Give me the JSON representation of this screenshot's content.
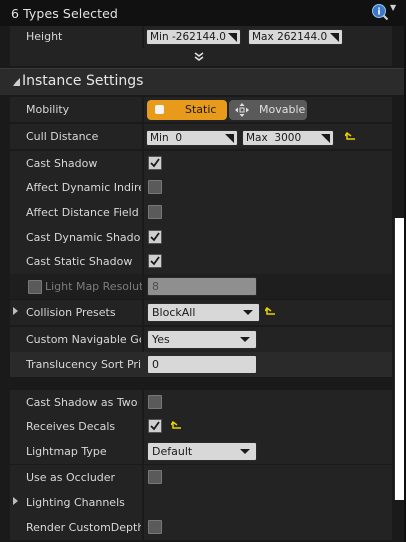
{
  "header": {
    "title": "6 Types Selected"
  },
  "height_row": {
    "label": "Height",
    "min_label": "Min",
    "min_value": "-262144.0",
    "max_label": "Max",
    "max_value": "262144.0"
  },
  "section": {
    "title": "Instance Settings"
  },
  "mobility": {
    "label": "Mobility",
    "options": [
      "Static",
      "Movable"
    ],
    "selected": "Static"
  },
  "cull_distance": {
    "label": "Cull Distance",
    "min_label": "Min",
    "min_value": "0",
    "max_label": "Max",
    "max_value": "3000"
  },
  "properties": [
    {
      "label": "Cast Shadow",
      "checked": true
    },
    {
      "label": "Affect Dynamic Indirect",
      "checked": false
    },
    {
      "label": "Affect Distance Field Li",
      "checked": false
    },
    {
      "label": "Cast Dynamic Shadow",
      "checked": true
    },
    {
      "label": "Cast Static Shadow",
      "checked": true
    }
  ],
  "light_map": {
    "label": "Light Map Resolutio",
    "value": "8"
  },
  "collision_presets": {
    "label": "Collision Presets",
    "value": "BlockAll"
  },
  "custom_navigable": {
    "label": "Custom Navigable Geor",
    "value": "Yes"
  },
  "translucency": {
    "label": "Translucency Sort Prio",
    "value": "0"
  },
  "cast_shadow_two_sided": {
    "label": "Cast Shadow as Two Si",
    "checked": false
  },
  "receives_decals": {
    "label": "Receives Decals",
    "checked": true
  },
  "lightmap_type": {
    "label": "Lightmap Type",
    "value": "Default"
  },
  "use_as_occluder": {
    "label": "Use as Occluder",
    "checked": false
  },
  "lighting_channels": {
    "label": "Lighting Channels"
  },
  "render_custom_depth": {
    "label": "Render CustomDepth P",
    "checked": false
  },
  "colors": {
    "accent": "#e89a1a",
    "reset_arrow": "#e8d400",
    "panel_bg": "#232323"
  }
}
